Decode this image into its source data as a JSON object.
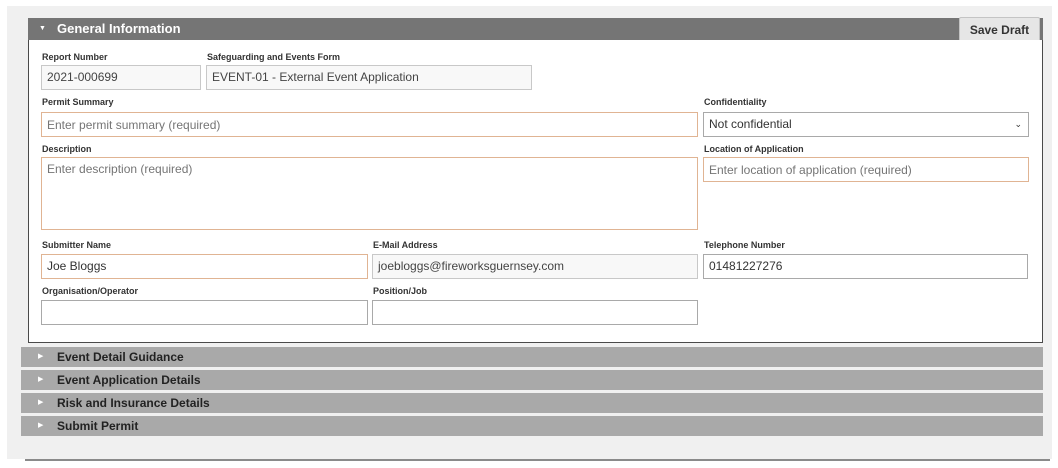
{
  "general": {
    "title": "General Information",
    "save_label": "Save Draft",
    "report_number": {
      "label": "Report Number",
      "value": "2021-000699"
    },
    "form": {
      "label": "Safeguarding and Events Form",
      "value": "EVENT-01 - External Event Application"
    },
    "permit_summary": {
      "label": "Permit Summary",
      "placeholder": "Enter permit summary (required)"
    },
    "confidentiality": {
      "label": "Confidentiality",
      "value": "Not confidential"
    },
    "description": {
      "label": "Description",
      "placeholder": "Enter description (required)"
    },
    "location": {
      "label": "Location of Application",
      "placeholder": "Enter location of application (required)"
    },
    "submitter": {
      "label": "Submitter Name",
      "value": "Joe Bloggs"
    },
    "email": {
      "label": "E-Mail Address",
      "value": "joebloggs@fireworksguernsey.com"
    },
    "telephone": {
      "label": "Telephone Number",
      "value": "01481227276"
    },
    "organisation": {
      "label": "Organisation/Operator",
      "value": ""
    },
    "position": {
      "label": "Position/Job",
      "value": ""
    }
  },
  "sections": [
    {
      "label": "Event Detail Guidance"
    },
    {
      "label": "Event Application Details"
    },
    {
      "label": "Risk and Insurance Details"
    },
    {
      "label": "Submit Permit"
    }
  ],
  "icons": {
    "expanded_caret": "caret-down-icon",
    "collapsed_caret": "caret-right-icon",
    "select_arrow": "chevron-down-icon"
  },
  "colors": {
    "header_bg": "#757575",
    "section_bg": "#a9a9a9",
    "required_border": "#e0b493"
  }
}
